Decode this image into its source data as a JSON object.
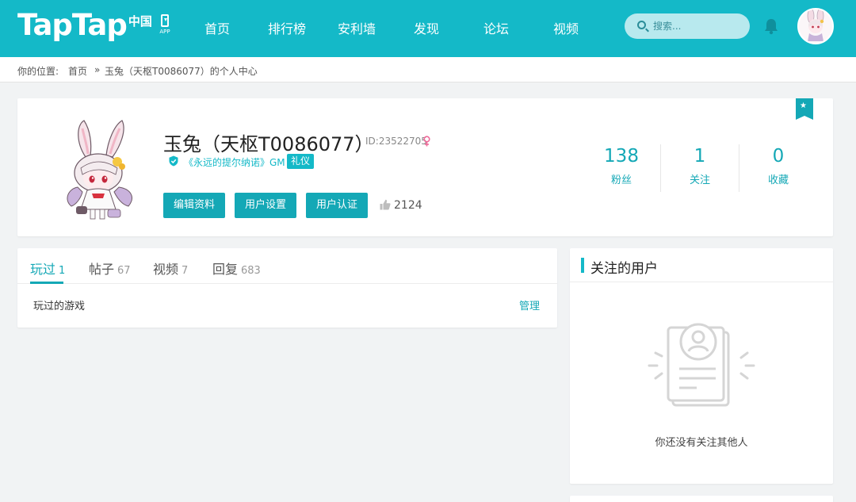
{
  "header": {
    "logo_main": "TapTap",
    "logo_cn": "中国",
    "app_label": "APP",
    "nav": [
      "首页",
      "排行榜",
      "安利墙",
      "发现",
      "论坛",
      "视频"
    ],
    "search_placeholder": "搜索...",
    "accent": "#14b9c8"
  },
  "breadcrumb": {
    "prefix": "你的位置:",
    "home": "首页",
    "sep": "»",
    "current": "玉兔（天枢T0086077）的个人中心"
  },
  "profile": {
    "name": "玉兔（天枢T0086077）",
    "id_text": "ID:23522705",
    "gm_text": "《永远的提尔纳诺》GM",
    "tag": "礼仪",
    "buttons": [
      "编辑资料",
      "用户设置",
      "用户认证"
    ],
    "likes": "2124",
    "stats": [
      {
        "num": "138",
        "label": "粉丝"
      },
      {
        "num": "1",
        "label": "关注"
      },
      {
        "num": "0",
        "label": "收藏"
      }
    ]
  },
  "tabs": [
    {
      "label": "玩过",
      "count": "1"
    },
    {
      "label": "帖子",
      "count": "67"
    },
    {
      "label": "视频",
      "count": "7"
    },
    {
      "label": "回复",
      "count": "683"
    }
  ],
  "played": {
    "title": "玩过的游戏",
    "manage": "管理"
  },
  "following": {
    "title": "关注的用户",
    "empty": "你还没有关注其他人"
  }
}
